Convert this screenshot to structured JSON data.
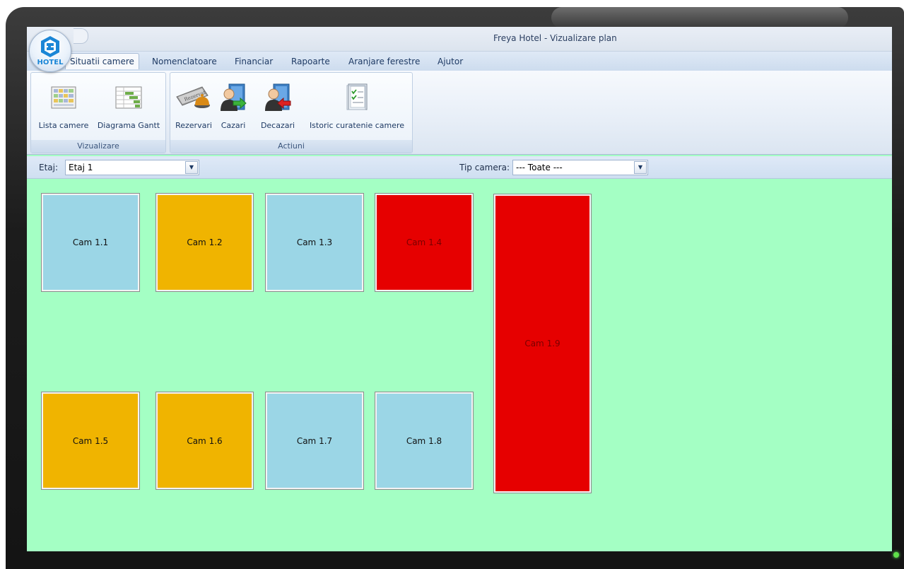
{
  "window": {
    "title": "Freya Hotel - Vizualizare plan"
  },
  "app_orb": {
    "text": "HOTEL",
    "icon": "hotel-logo-icon"
  },
  "menu": {
    "tabs": [
      {
        "label": "Situatii camere",
        "active": true
      },
      {
        "label": "Nomenclatoare"
      },
      {
        "label": "Financiar"
      },
      {
        "label": "Rapoarte"
      },
      {
        "label": "Aranjare ferestre"
      },
      {
        "label": "Ajutor"
      }
    ]
  },
  "ribbon": {
    "groups": [
      {
        "label": "Vizualizare",
        "buttons": [
          {
            "label": "Lista camere",
            "icon": "room-list-icon"
          },
          {
            "label": "Diagrama Gantt",
            "icon": "gantt-chart-icon"
          }
        ]
      },
      {
        "label": "Actiuni",
        "buttons": [
          {
            "label": "Rezervari",
            "icon": "reservation-bell-icon"
          },
          {
            "label": "Cazari",
            "icon": "check-in-icon"
          },
          {
            "label": "Decazari",
            "icon": "check-out-icon"
          },
          {
            "label": "Istoric curatenie camere",
            "icon": "cleaning-history-icon"
          }
        ]
      }
    ]
  },
  "filters": {
    "floor": {
      "label": "Etaj:",
      "value": "Etaj 1"
    },
    "room_type": {
      "label": "Tip camera:",
      "value": "--- Toate ---"
    }
  },
  "colors": {
    "plan_background": "#a4ffc4",
    "free": "#9bd6e6",
    "reserved": "#f0b400",
    "occupied": "#e60000"
  },
  "rooms": [
    {
      "label": "Cam 1.1",
      "status": "free"
    },
    {
      "label": "Cam 1.2",
      "status": "reserved"
    },
    {
      "label": "Cam 1.3",
      "status": "free"
    },
    {
      "label": "Cam 1.4",
      "status": "occupied"
    },
    {
      "label": "Cam 1.5",
      "status": "reserved"
    },
    {
      "label": "Cam 1.6",
      "status": "reserved"
    },
    {
      "label": "Cam 1.7",
      "status": "free"
    },
    {
      "label": "Cam 1.8",
      "status": "free"
    },
    {
      "label": "Cam 1.9",
      "status": "occupied"
    }
  ]
}
